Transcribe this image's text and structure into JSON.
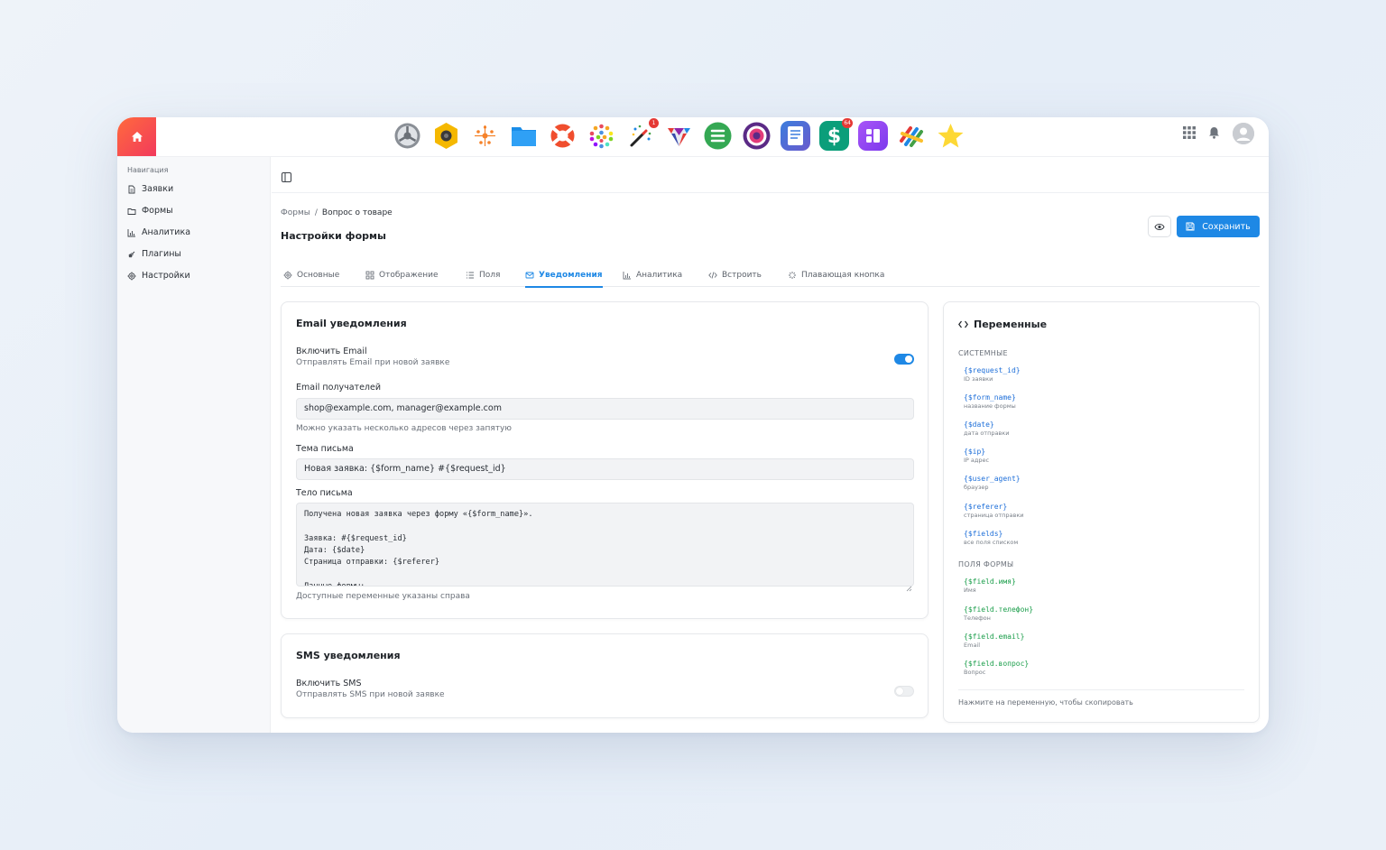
{
  "dock": {
    "apps": [
      {
        "icon": "gear-icon",
        "badge": ""
      },
      {
        "icon": "camera-hex-icon",
        "badge": ""
      },
      {
        "icon": "sparkles-icon",
        "badge": ""
      },
      {
        "icon": "folder-icon",
        "badge": ""
      },
      {
        "icon": "lifebuoy-icon",
        "badge": ""
      },
      {
        "icon": "color-dots-icon",
        "badge": ""
      },
      {
        "icon": "magic-wand-icon",
        "badge": "1"
      },
      {
        "icon": "gem-icon",
        "badge": ""
      },
      {
        "icon": "list-icon",
        "badge": ""
      },
      {
        "icon": "target-icon",
        "badge": ""
      },
      {
        "icon": "document-icon",
        "badge": ""
      },
      {
        "icon": "dollar-icon",
        "badge": "64"
      },
      {
        "icon": "widgets-icon",
        "badge": ""
      },
      {
        "icon": "stripes-icon",
        "badge": ""
      },
      {
        "icon": "star-icon",
        "badge": ""
      }
    ]
  },
  "sidebar": {
    "title": "Навигация",
    "items": [
      {
        "label": "Заявки",
        "icon": "document-icon"
      },
      {
        "label": "Формы",
        "icon": "folder-icon"
      },
      {
        "label": "Аналитика",
        "icon": "chart-icon"
      },
      {
        "label": "Плагины",
        "icon": "plug-icon"
      },
      {
        "label": "Настройки",
        "icon": "gear-icon"
      }
    ]
  },
  "header": {
    "breadcrumb_root": "Формы",
    "breadcrumb_sep": "/",
    "breadcrumb_current": "Вопрос о товаре",
    "title": "Настройки формы",
    "save_label": "Сохранить"
  },
  "tabs": [
    {
      "label": "Основные",
      "icon": "gear-icon"
    },
    {
      "label": "Отображение",
      "icon": "grid-icon"
    },
    {
      "label": "Поля",
      "icon": "list-icon"
    },
    {
      "label": "Уведомления",
      "icon": "mail-icon",
      "active": true
    },
    {
      "label": "Аналитика",
      "icon": "chart-icon"
    },
    {
      "label": "Встроить",
      "icon": "code-icon"
    },
    {
      "label": "Плавающая кнопка",
      "icon": "sparkle-icon"
    }
  ],
  "email": {
    "title": "Email уведомления",
    "enable_label": "Включить Email",
    "enable_desc": "Отправлять Email при новой заявке",
    "enabled": true,
    "recipients_label": "Email получателей",
    "recipients_value": "shop@example.com, manager@example.com",
    "recipients_hint": "Можно указать несколько адресов через запятую",
    "subject_label": "Тема письма",
    "subject_value": "Новая заявка: {$form_name} #{$request_id}",
    "body_label": "Тело письма",
    "body_value": "Получена новая заявка через форму «{$form_name}».\n\nЗаявка: #{$request_id}\nДата: {$date}\nСтраница отправки: {$referer}\n\nДанные формы:",
    "body_hint": "Доступные переменные указаны справа"
  },
  "sms": {
    "title": "SMS уведомления",
    "enable_label": "Включить SMS",
    "enable_desc": "Отправлять SMS при новой заявке",
    "enabled": false
  },
  "variables": {
    "title": "Переменные",
    "system_title": "СИСТЕМНЫЕ",
    "system": [
      {
        "code": "{$request_id}",
        "desc": "ID заявки"
      },
      {
        "code": "{$form_name}",
        "desc": "название формы"
      },
      {
        "code": "{$date}",
        "desc": "дата отправки"
      },
      {
        "code": "{$ip}",
        "desc": "IP адрес"
      },
      {
        "code": "{$user_agent}",
        "desc": "браузер"
      },
      {
        "code": "{$referer}",
        "desc": "страница отправки"
      },
      {
        "code": "{$fields}",
        "desc": "все поля списком"
      }
    ],
    "fields_title": "ПОЛЯ ФОРМЫ",
    "fields": [
      {
        "code": "{$field.имя}",
        "desc": "Имя"
      },
      {
        "code": "{$field.телефон}",
        "desc": "Телефон"
      },
      {
        "code": "{$field.email}",
        "desc": "Email"
      },
      {
        "code": "{$field.вопрос}",
        "desc": "Вопрос"
      }
    ],
    "hint": "Нажмите на переменную, чтобы скопировать"
  },
  "colors": {
    "accent": "#1e88e5",
    "system_var": "#1e6fd9",
    "field_var": "#1b9e4b",
    "home_gradient_start": "#ff6a3d",
    "home_gradient_end": "#f23a5c"
  }
}
